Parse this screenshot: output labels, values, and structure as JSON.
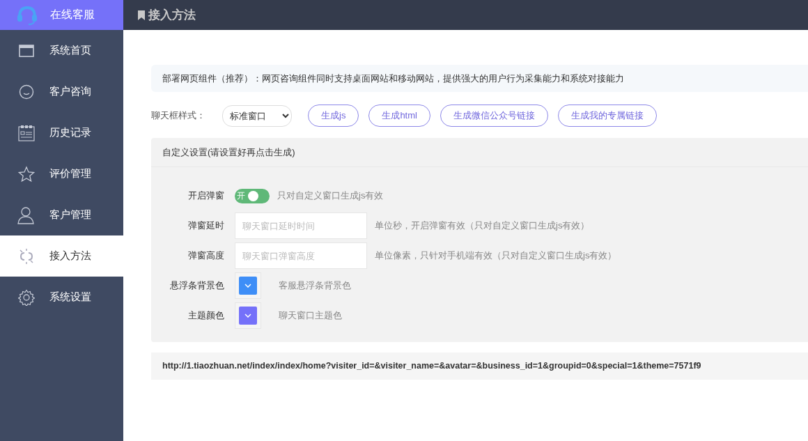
{
  "brand": {
    "title": "在线客服"
  },
  "sidebar": {
    "items": [
      {
        "label": "系统首页",
        "selected": false
      },
      {
        "label": "客户咨询",
        "selected": false
      },
      {
        "label": "历史记录",
        "selected": false
      },
      {
        "label": "评价管理",
        "selected": false
      },
      {
        "label": "客户管理",
        "selected": false
      },
      {
        "label": "接入方法",
        "selected": true
      },
      {
        "label": "系统设置",
        "selected": false
      }
    ]
  },
  "header": {
    "title": "接入方法"
  },
  "notice": "部署网页组件（推荐）：网页咨询组件同时支持桌面网站和移动网站，提供强大的用户行为采集能力和系统对接能力",
  "style_row": {
    "label": "聊天框样式：",
    "select_value": "标准窗口",
    "buttons": [
      "生成js",
      "生成html",
      "生成微信公众号链接",
      "生成我的专属链接"
    ]
  },
  "custom_panel": {
    "title": "自定义设置(请设置好再点击生成)",
    "rows": [
      {
        "kind": "toggle",
        "label": "开启弹窗",
        "on": true,
        "toggle_text": "开",
        "hint": "只对自定义窗口生成js有效"
      },
      {
        "kind": "input",
        "label": "弹窗延时",
        "placeholder": "聊天窗口延时时间",
        "hint": "单位秒，开启弹窗有效（只对自定义窗口生成js有效）"
      },
      {
        "kind": "input",
        "label": "弹窗高度",
        "placeholder": "聊天窗口弹窗高度",
        "hint": "单位像素，只针对手机端有效（只对自定义窗口生成js有效）"
      },
      {
        "kind": "color",
        "label": "悬浮条背景色",
        "color": "#3e8ef7",
        "hint": "客服悬浮条背景色"
      },
      {
        "kind": "color",
        "label": "主题颜色",
        "color": "#7571f9",
        "hint": "聊天窗口主题色"
      }
    ]
  },
  "url": "http://1.tiaozhuan.net/index/index/home?visiter_id=&visiter_name=&avatar=&business_id=1&groupid=0&special=1&theme=7571f9"
}
